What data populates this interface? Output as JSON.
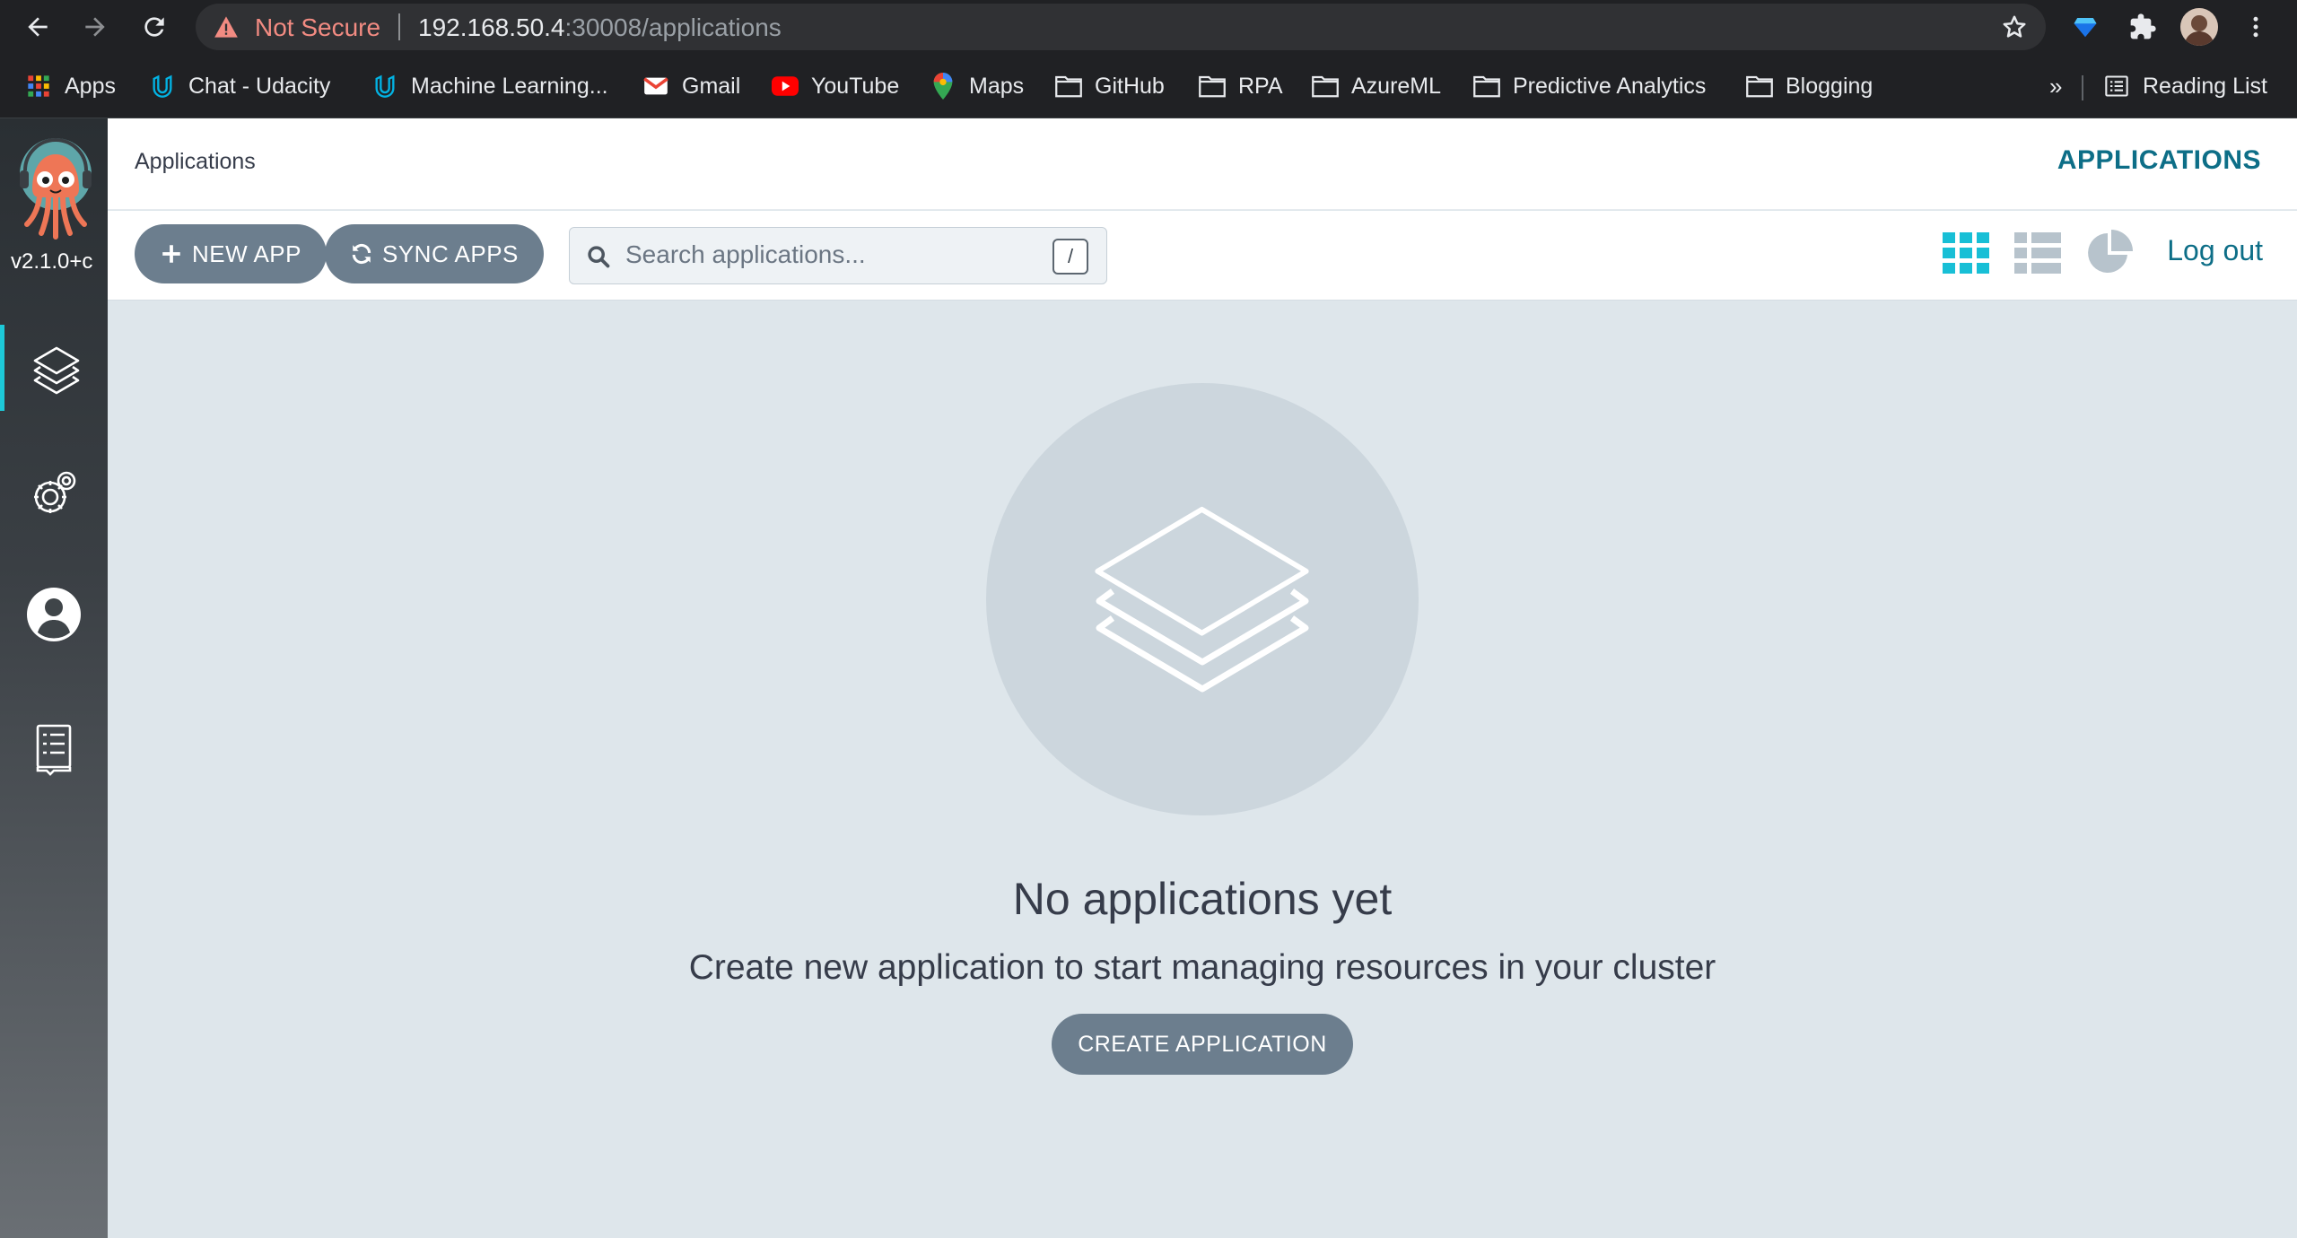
{
  "browser": {
    "security_label": "Not Secure",
    "url_host": "192.168.50.4",
    "url_path": ":30008/applications",
    "icons": [
      "back-icon",
      "forward-icon",
      "reload-icon",
      "warning-icon",
      "star-icon",
      "extension-gem-icon",
      "puzzle-icon",
      "profile-avatar",
      "kebab-menu-icon"
    ]
  },
  "bookmarks": {
    "items": [
      {
        "label": "Apps",
        "icon": "apps-grid-icon"
      },
      {
        "label": "Chat - Udacity",
        "icon": "udacity-icon"
      },
      {
        "label": "Machine Learning...",
        "icon": "udacity-icon"
      },
      {
        "label": "Gmail",
        "icon": "gmail-icon"
      },
      {
        "label": "YouTube",
        "icon": "youtube-icon"
      },
      {
        "label": "Maps",
        "icon": "maps-pin-icon"
      },
      {
        "label": "GitHub",
        "icon": "folder-icon"
      },
      {
        "label": "RPA",
        "icon": "folder-icon"
      },
      {
        "label": "AzureML",
        "icon": "folder-icon"
      },
      {
        "label": "Predictive Analytics",
        "icon": "folder-icon"
      },
      {
        "label": "Blogging",
        "icon": "folder-icon"
      }
    ],
    "overflow": "»",
    "reading_list": "Reading List"
  },
  "sidebar": {
    "version": "v2.1.0+c",
    "items": [
      {
        "name": "applications",
        "icon": "layers-icon",
        "active": true
      },
      {
        "name": "settings",
        "icon": "gears-icon",
        "active": false
      },
      {
        "name": "user-info",
        "icon": "user-icon",
        "active": false
      },
      {
        "name": "documentation",
        "icon": "docs-icon",
        "active": false
      }
    ]
  },
  "header": {
    "breadcrumb": "Applications",
    "title": "APPLICATIONS"
  },
  "toolbar": {
    "new_app": "NEW APP",
    "sync_apps": "SYNC APPS",
    "search_placeholder": "Search applications...",
    "search_shortcut": "/",
    "views": [
      "tiles-view-icon",
      "list-view-icon",
      "summary-pie-icon"
    ],
    "logout": "Log out"
  },
  "empty_state": {
    "title": "No applications yet",
    "subtitle": "Create new application to start managing resources in your cluster",
    "cta": "CREATE APPLICATION"
  },
  "colors": {
    "accent": "#0d6e87",
    "button": "#6c7e8e",
    "active_indicator": "#1dc9d8",
    "empty_bg": "#dee6eb",
    "warning": "#f28b82"
  }
}
